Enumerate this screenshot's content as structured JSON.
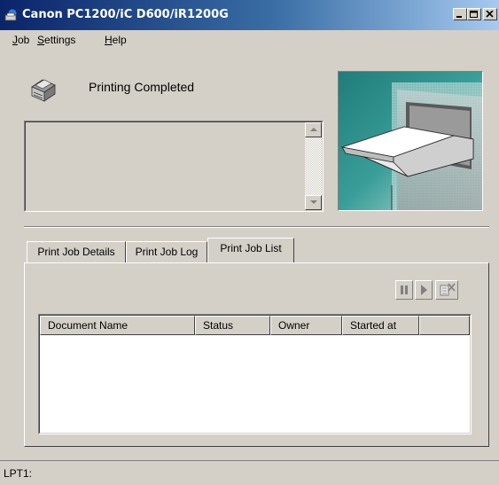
{
  "window": {
    "title": "Canon PC1200/iC D600/iR1200G"
  },
  "menu": {
    "items": [
      {
        "accel": "J",
        "rest": "ob"
      },
      {
        "accel": "S",
        "rest": "ettings"
      },
      {
        "accel": "H",
        "rest": "elp"
      }
    ]
  },
  "status": {
    "message": "Printing Completed",
    "details": ""
  },
  "tabs": [
    {
      "label": "Print Job Details",
      "active": false
    },
    {
      "label": "Print Job Log",
      "active": false
    },
    {
      "label": "Print Job List",
      "active": true
    }
  ],
  "job_list": {
    "columns": [
      "Document Name",
      "Status",
      "Owner",
      "Started at",
      ""
    ],
    "rows": []
  },
  "statusbar": {
    "port": "LPT1:"
  },
  "icons": {
    "app": "printer-globe-icon",
    "printer": "printer-icon",
    "pause": "pause-icon",
    "resume": "play-icon",
    "cancel": "cancel-job-icon",
    "minimize": "minimize-icon",
    "maximize": "maximize-icon",
    "close": "close-icon"
  },
  "colors": {
    "titlebar_start": "#0a246a",
    "titlebar_end": "#a6caf0",
    "face": "#d4d0c8",
    "illustration_teal": "#2d8a86"
  }
}
